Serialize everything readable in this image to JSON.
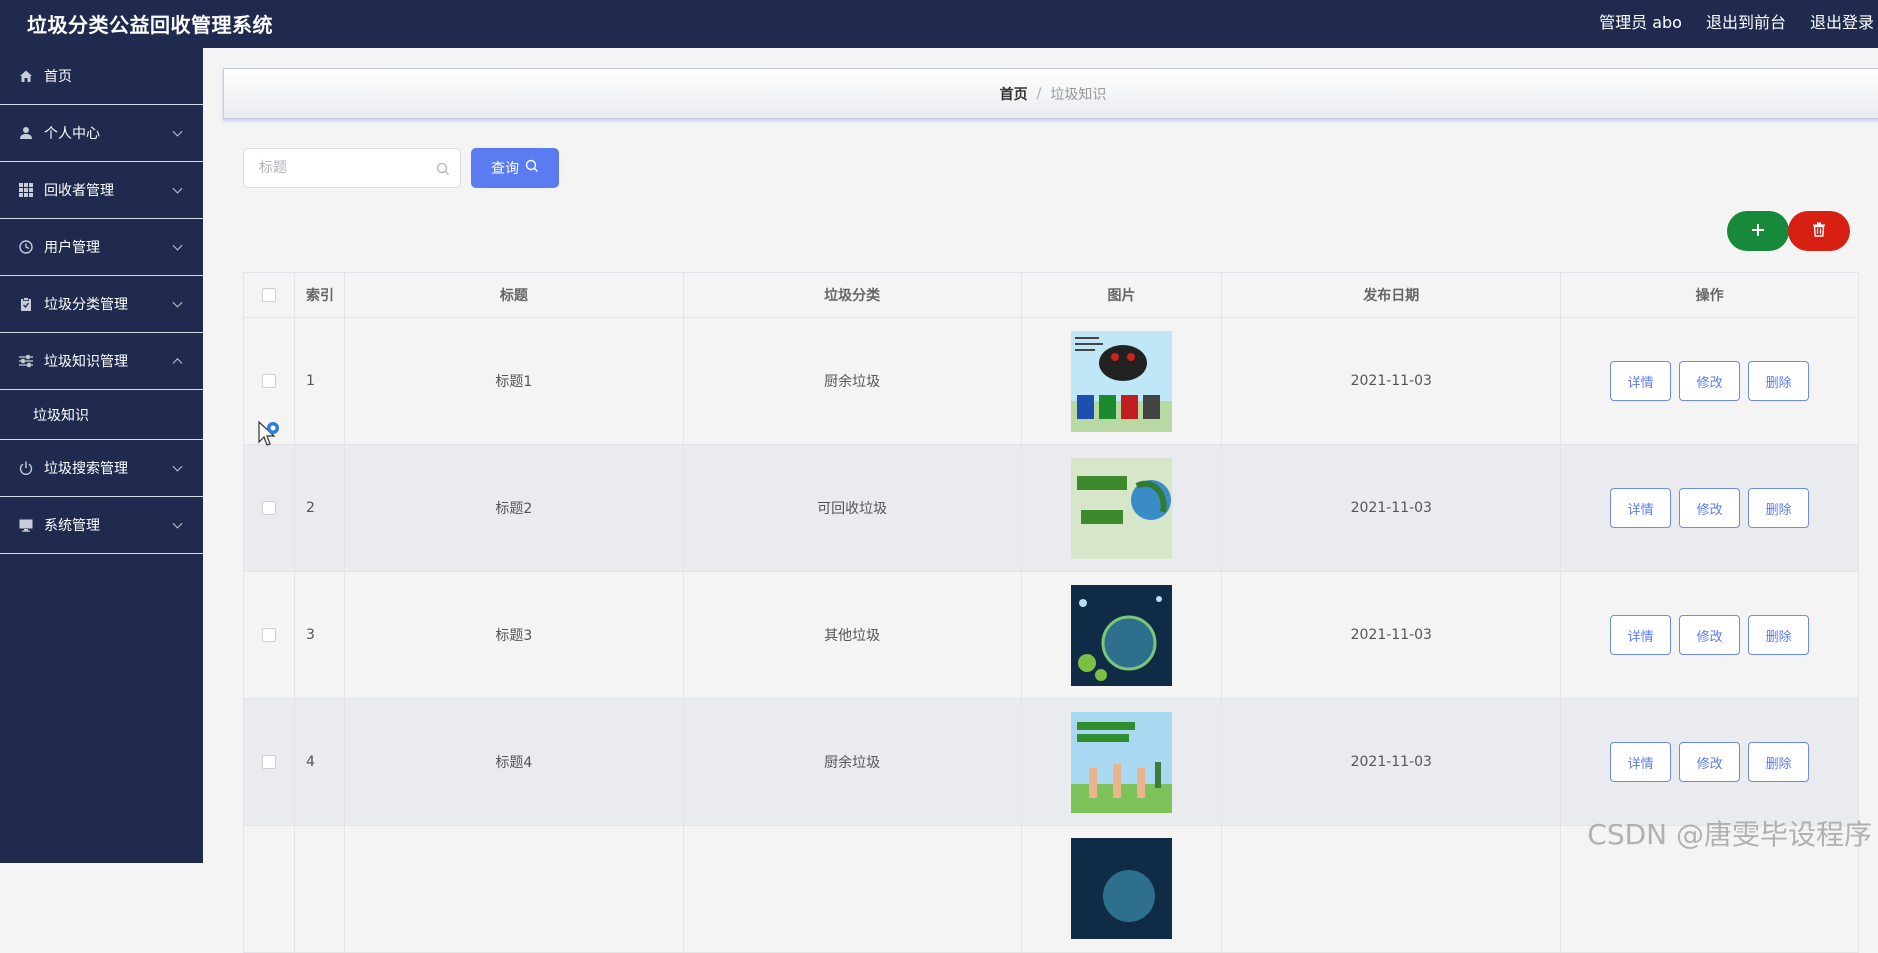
{
  "app": {
    "title": "垃圾分类公益回收管理系统",
    "admin_label": "管理员 abo",
    "to_front_label": "退出到前台",
    "logout_label": "退出登录"
  },
  "sidebar": {
    "items": [
      {
        "label": "首页",
        "icon": "home-icon"
      },
      {
        "label": "个人中心",
        "icon": "user-icon"
      },
      {
        "label": "回收者管理",
        "icon": "grid-icon"
      },
      {
        "label": "用户管理",
        "icon": "clock-icon"
      },
      {
        "label": "垃圾分类管理",
        "icon": "clipboard-icon"
      },
      {
        "label": "垃圾知识管理",
        "icon": "sliders-icon",
        "expanded": true
      },
      {
        "label": "垃圾知识",
        "sub": true
      },
      {
        "label": "垃圾搜索管理",
        "icon": "power-icon"
      },
      {
        "label": "系统管理",
        "icon": "monitor-icon"
      }
    ]
  },
  "breadcrumb": {
    "home": "首页",
    "separator": "/",
    "current": "垃圾知识"
  },
  "search": {
    "placeholder": "标题",
    "button_label": "查询"
  },
  "colors": {
    "accent": "#5b7cf0",
    "add": "#16893a",
    "delete": "#d71f12",
    "sidebar": "#1f2a4e"
  },
  "table": {
    "headers": {
      "index": "索引",
      "title": "标题",
      "category": "垃圾分类",
      "image": "图片",
      "date": "发布日期",
      "actions": "操作"
    },
    "rows": [
      {
        "index": "1",
        "title": "标题1",
        "category": "厨余垃圾",
        "date": "2021-11-03"
      },
      {
        "index": "2",
        "title": "标题2",
        "category": "可回收垃圾",
        "date": "2021-11-03"
      },
      {
        "index": "3",
        "title": "标题3",
        "category": "其他垃圾",
        "date": "2021-11-03"
      },
      {
        "index": "4",
        "title": "标题4",
        "category": "厨余垃圾",
        "date": "2021-11-03"
      }
    ],
    "action_labels": {
      "detail": "详情",
      "edit": "修改",
      "delete": "删除"
    }
  },
  "watermark": "CSDN @唐雯毕设程序"
}
